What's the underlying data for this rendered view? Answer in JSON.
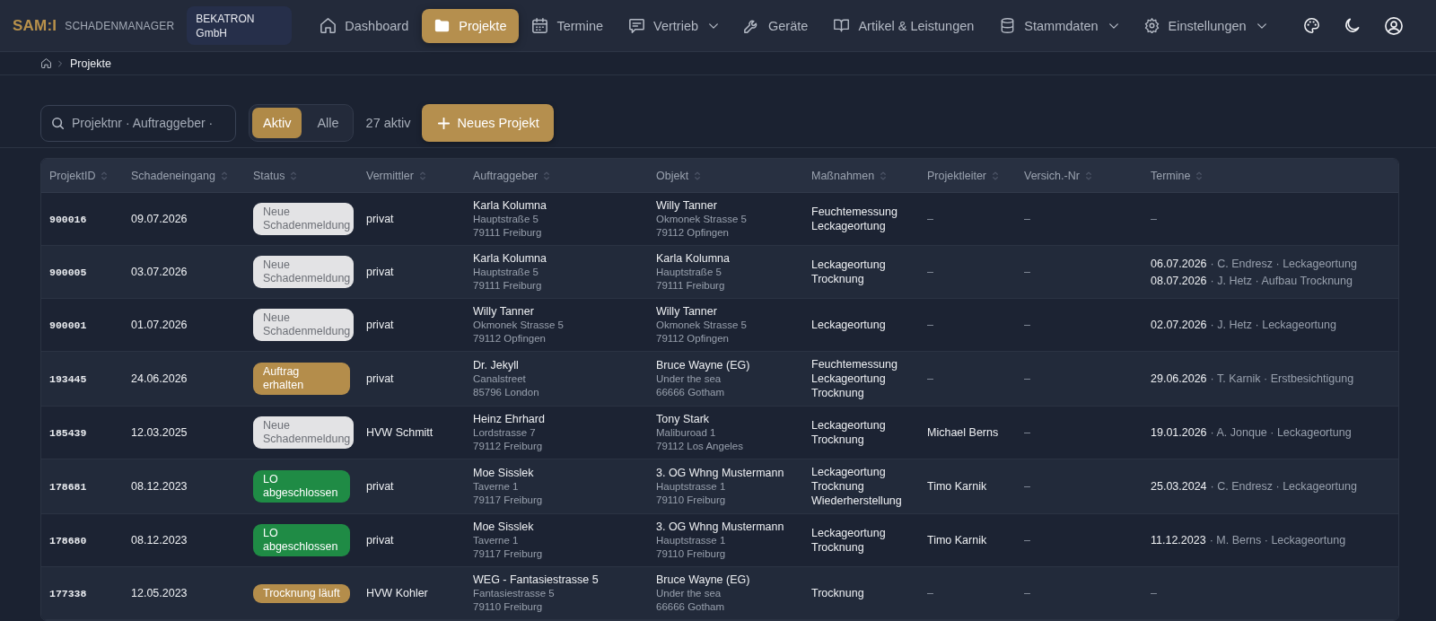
{
  "header": {
    "logo": "SAM:I",
    "product": "SCHADENMANAGER",
    "company": "BEKATRON GmbH",
    "nav": [
      {
        "label": "Dashboard",
        "selected": false,
        "menu": false
      },
      {
        "label": "Projekte",
        "selected": true,
        "menu": false
      },
      {
        "label": "Termine",
        "selected": false,
        "menu": false
      },
      {
        "label": "Vertrieb",
        "selected": false,
        "menu": true
      },
      {
        "label": "Geräte",
        "selected": false,
        "menu": false
      },
      {
        "label": "Artikel & Leistungen",
        "selected": false,
        "menu": false
      },
      {
        "label": "Stammdaten",
        "selected": false,
        "menu": true
      },
      {
        "label": "Einstellungen",
        "selected": false,
        "menu": true
      }
    ]
  },
  "breadcrumb": [
    "Projekte"
  ],
  "toolbar": {
    "search": {
      "placeholder": "Projektnr · Auftraggeber ·"
    },
    "filters": [
      {
        "label": "Aktiv",
        "selected": true
      },
      {
        "label": "Alle",
        "selected": false
      }
    ],
    "count": "27 aktiv",
    "new_button": "Neues Projekt"
  },
  "table": {
    "columns": [
      "ProjektID",
      "Schadeneingang",
      "Status",
      "Vermittler",
      "Auftraggeber",
      "Objekt",
      "Maßnahmen",
      "Projektleiter",
      "Versich.-Nr",
      "Termine"
    ],
    "rows": [
      {
        "id": "900016",
        "received": "09.07.2026",
        "status": {
          "label": "Neue\nSchadenmeldung",
          "color": "#e3e3e5"
        },
        "agent": "privat",
        "client": {
          "name": "Karla Kolumna",
          "street": "Hauptstraße 5",
          "city": "79111 Freiburg"
        },
        "object": {
          "name": "Willy Tanner",
          "street": "Okmonek Strasse 5",
          "city": "79112 Opfingen"
        },
        "measures": [
          "Feuchtemessung",
          "Leckageortung"
        ],
        "manager": "–",
        "policy_no": "–",
        "appointments": [
          {
            "date": "–"
          }
        ]
      },
      {
        "id": "900005",
        "received": "03.07.2026",
        "status": {
          "label": "Neue\nSchadenmeldung",
          "color": "#e3e3e5"
        },
        "agent": "privat",
        "client": {
          "name": "Karla Kolumna",
          "street": "Hauptstraße 5",
          "city": "79111 Freiburg"
        },
        "object": {
          "name": "Karla Kolumna",
          "street": "Hauptstraße 5",
          "city": "79111 Freiburg"
        },
        "measures": [
          "Leckageortung",
          "Trocknung"
        ],
        "manager": "–",
        "policy_no": "–",
        "appointments": [
          {
            "date": "06.07.2026",
            "detail": "· C. Endresz · Leckageortung"
          },
          {
            "date": "08.07.2026",
            "detail": "· J. Hetz · Aufbau Trocknung"
          }
        ]
      },
      {
        "id": "900001",
        "received": "01.07.2026",
        "status": {
          "label": "Neue\nSchadenmeldung",
          "color": "#e3e3e5"
        },
        "agent": "privat",
        "client": {
          "name": "Willy Tanner",
          "street": "Okmonek Strasse 5",
          "city": "79112 Opfingen"
        },
        "object": {
          "name": "Willy Tanner",
          "street": "Okmonek Strasse 5",
          "city": "79112 Opfingen"
        },
        "measures": [
          "Leckageortung"
        ],
        "manager": "–",
        "policy_no": "–",
        "appointments": [
          {
            "date": "02.07.2026",
            "detail": "· J. Hetz · Leckageortung"
          }
        ]
      },
      {
        "id": "193445",
        "received": "24.06.2026",
        "status": {
          "label": "Auftrag\nerhalten",
          "color": "#b48d4b"
        },
        "agent": "privat",
        "client": {
          "name": "Dr. Jekyll",
          "street": "Canalstreet",
          "city": "85796 London"
        },
        "object": {
          "name": "Bruce Wayne (EG)",
          "street": "Under the sea",
          "city": "66666 Gotham"
        },
        "measures": [
          "Feuchtemessung",
          "Leckageortung",
          "Trocknung"
        ],
        "manager": "–",
        "policy_no": "–",
        "appointments": [
          {
            "date": "29.06.2026",
            "detail": "· T. Karnik · Erstbesichtigung"
          }
        ]
      },
      {
        "id": "185439",
        "received": "12.03.2025",
        "status": {
          "label": "Neue\nSchadenmeldung",
          "color": "#e3e3e5"
        },
        "agent": "HVW Schmitt",
        "client": {
          "name": "Heinz Ehrhard",
          "street": "Lordstrasse 7",
          "city": "79112 Freiburg"
        },
        "object": {
          "name": "Tony Stark",
          "street": "Maliburoad 1",
          "city": "79112 Los Angeles"
        },
        "measures": [
          "Leckageortung",
          "Trocknung"
        ],
        "manager": "Michael Berns",
        "policy_no": "–",
        "appointments": [
          {
            "date": "19.01.2026",
            "detail": "· A. Jonque · Leckageortung"
          }
        ]
      },
      {
        "id": "178681",
        "received": "08.12.2023",
        "status": {
          "label": "LO\nabgeschlossen",
          "color": "#1f8b45"
        },
        "agent": "privat",
        "client": {
          "name": "Moe Sisslek",
          "street": "Taverne 1",
          "city": "79117 Freiburg"
        },
        "object": {
          "name": "3. OG Whng Mustermann",
          "street": "Hauptstrasse 1",
          "city": "79110 Freiburg"
        },
        "measures": [
          "Leckageortung",
          "Trocknung",
          "Wiederherstellung"
        ],
        "manager": "Timo Karnik",
        "policy_no": "–",
        "appointments": [
          {
            "date": "25.03.2024",
            "detail": "· C. Endresz · Leckageortung"
          }
        ]
      },
      {
        "id": "178680",
        "received": "08.12.2023",
        "status": {
          "label": "LO\nabgeschlossen",
          "color": "#1f8b45"
        },
        "agent": "privat",
        "client": {
          "name": "Moe Sisslek",
          "street": "Taverne 1",
          "city": "79117 Freiburg"
        },
        "object": {
          "name": "3. OG Whng Mustermann",
          "street": "Hauptstrasse 1",
          "city": "79110 Freiburg"
        },
        "measures": [
          "Leckageortung",
          "Trocknung"
        ],
        "manager": "Timo Karnik",
        "policy_no": "–",
        "appointments": [
          {
            "date": "11.12.2023",
            "detail": "· M. Berns · Leckageortung"
          }
        ]
      },
      {
        "id": "177338",
        "received": "12.05.2023",
        "status": {
          "label": "Trocknung läuft",
          "color": "#b48d4b"
        },
        "agent": "HVW Kohler",
        "client": {
          "name": "WEG - Fantasiestrasse 5",
          "street": "Fantasiestrasse 5",
          "city": "79110 Freiburg"
        },
        "object": {
          "name": "Bruce Wayne (EG)",
          "street": "Under the sea",
          "city": "66666 Gotham"
        },
        "measures": [
          "Trocknung"
        ],
        "manager": "–",
        "policy_no": "–",
        "appointments": [
          {
            "date": "–"
          }
        ]
      }
    ]
  }
}
